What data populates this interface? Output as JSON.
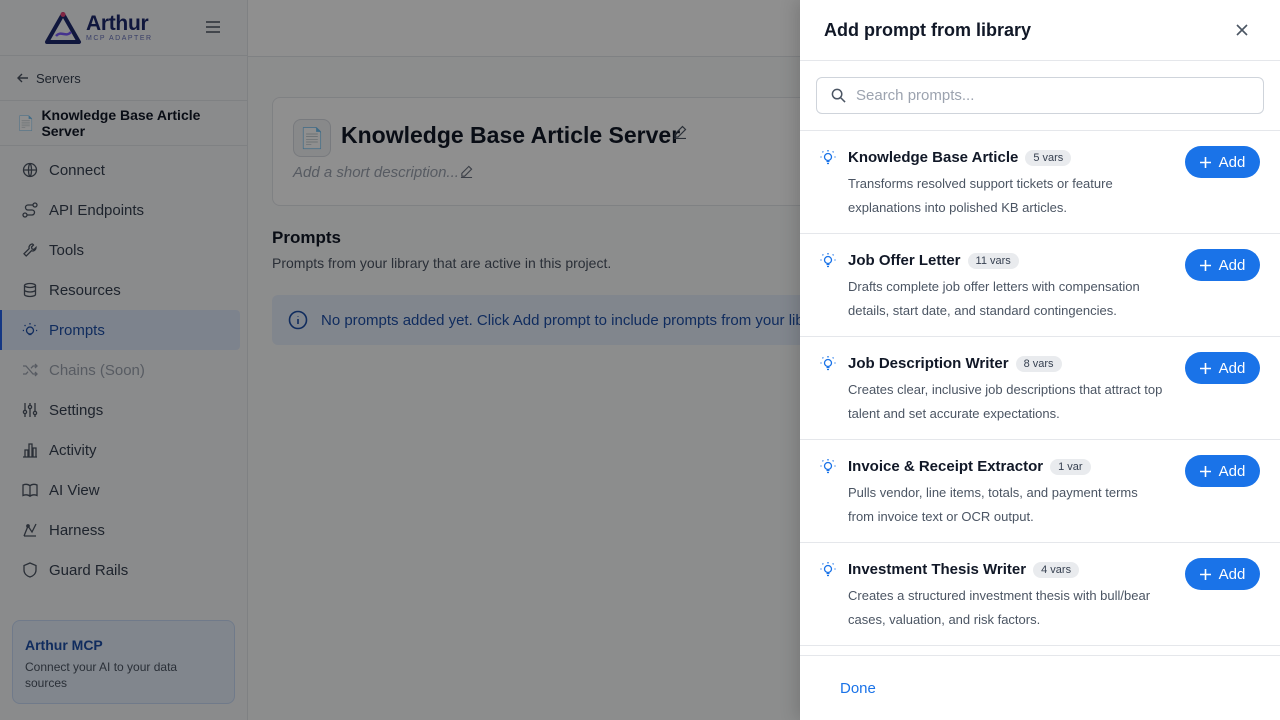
{
  "brand": {
    "name": "Arthur",
    "subtitle": "MCP ADAPTER"
  },
  "sidebar": {
    "back_label": "Servers",
    "server_name": "Knowledge Base Article Server",
    "server_icon": "📄",
    "items": [
      {
        "label": "Connect",
        "icon": "globe-icon"
      },
      {
        "label": "API Endpoints",
        "icon": "route-icon"
      },
      {
        "label": "Tools",
        "icon": "wrench-icon"
      },
      {
        "label": "Resources",
        "icon": "database-icon"
      },
      {
        "label": "Prompts",
        "icon": "bulb-icon",
        "active": true
      },
      {
        "label": "Chains (Soon)",
        "icon": "shuffle-icon",
        "disabled": true
      },
      {
        "label": "Settings",
        "icon": "sliders-icon"
      },
      {
        "label": "Activity",
        "icon": "bar-chart-icon"
      },
      {
        "label": "AI View",
        "icon": "book-icon"
      },
      {
        "label": "Harness",
        "icon": "harness-icon"
      },
      {
        "label": "Guard Rails",
        "icon": "shield-icon"
      }
    ],
    "promo": {
      "title": "Arthur MCP",
      "text": "Connect your AI to your data sources"
    }
  },
  "main": {
    "server_title": "Knowledge Base Article Server",
    "server_icon": "📄",
    "description_placeholder": "Add a short description...",
    "section_title": "Prompts",
    "section_subtitle": "Prompts from your library that are active in this project.",
    "info_text": "No prompts added yet. Click Add prompt to include prompts from your library."
  },
  "drawer": {
    "title": "Add prompt from library",
    "search_placeholder": "Search prompts...",
    "add_label": "Add",
    "done_label": "Done",
    "prompts": [
      {
        "name": "Knowledge Base Article",
        "vars": "5 vars",
        "description": "Transforms resolved support tickets or feature explanations into polished KB articles."
      },
      {
        "name": "Job Offer Letter",
        "vars": "11 vars",
        "description": "Drafts complete job offer letters with compensation details, start date, and standard contingencies."
      },
      {
        "name": "Job Description Writer",
        "vars": "8 vars",
        "description": "Creates clear, inclusive job descriptions that attract top talent and set accurate expectations."
      },
      {
        "name": "Invoice & Receipt Extractor",
        "vars": "1 var",
        "description": "Pulls vendor, line items, totals, and payment terms from invoice text or OCR output."
      },
      {
        "name": "Investment Thesis Writer",
        "vars": "4 vars",
        "description": "Creates a structured investment thesis with bull/bear cases, valuation, and risk factors."
      }
    ]
  },
  "colors": {
    "accent": "#1a73e8",
    "brand_navy": "#1e2a6e",
    "info_bg": "#e6effc"
  }
}
